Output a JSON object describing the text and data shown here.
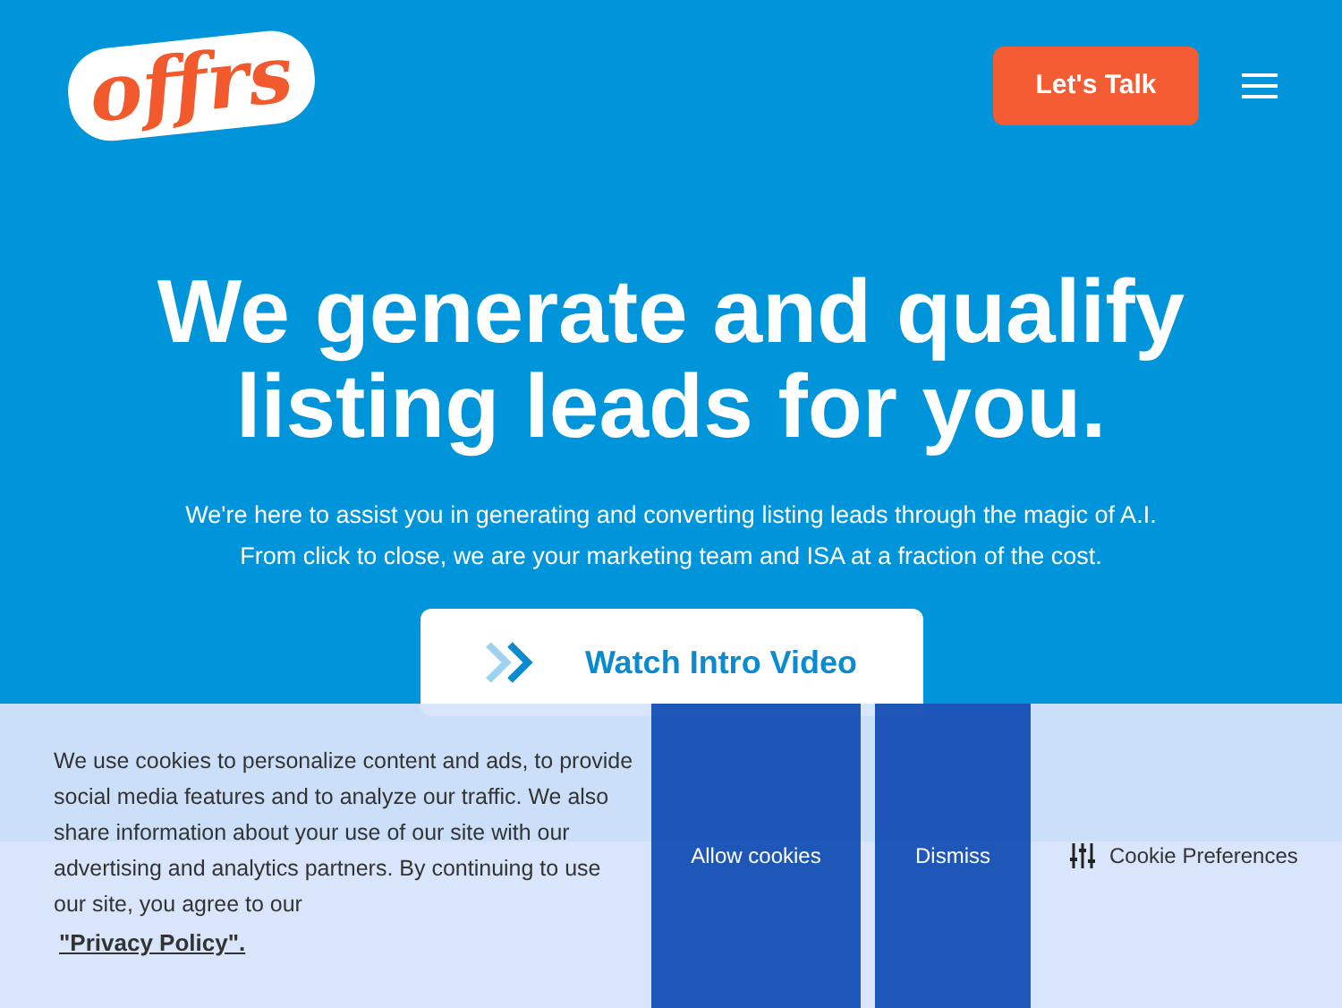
{
  "header": {
    "logo": "offrs",
    "cta": "Let's Talk"
  },
  "hero": {
    "title": "We generate and qualify listing leads for you.",
    "subtitle_lines": [
      "We're here to assist you in generating and converting listing leads through the magic of A.I.",
      "From click to close, we are your marketing team and ISA at a fraction of the cost."
    ],
    "video_button": "Watch Intro Video"
  },
  "cookie_banner": {
    "message": "We use cookies to personalize content and ads, to provide social media features and to analyze our traffic. We also share information about your use of our site with our advertising and analytics partners. By continuing to use our site, you agree to our",
    "policy_link": "\"Privacy Policy\".",
    "buttons": [
      "Allow cookies",
      "Dismiss"
    ],
    "preferences": "Cookie Preferences"
  }
}
